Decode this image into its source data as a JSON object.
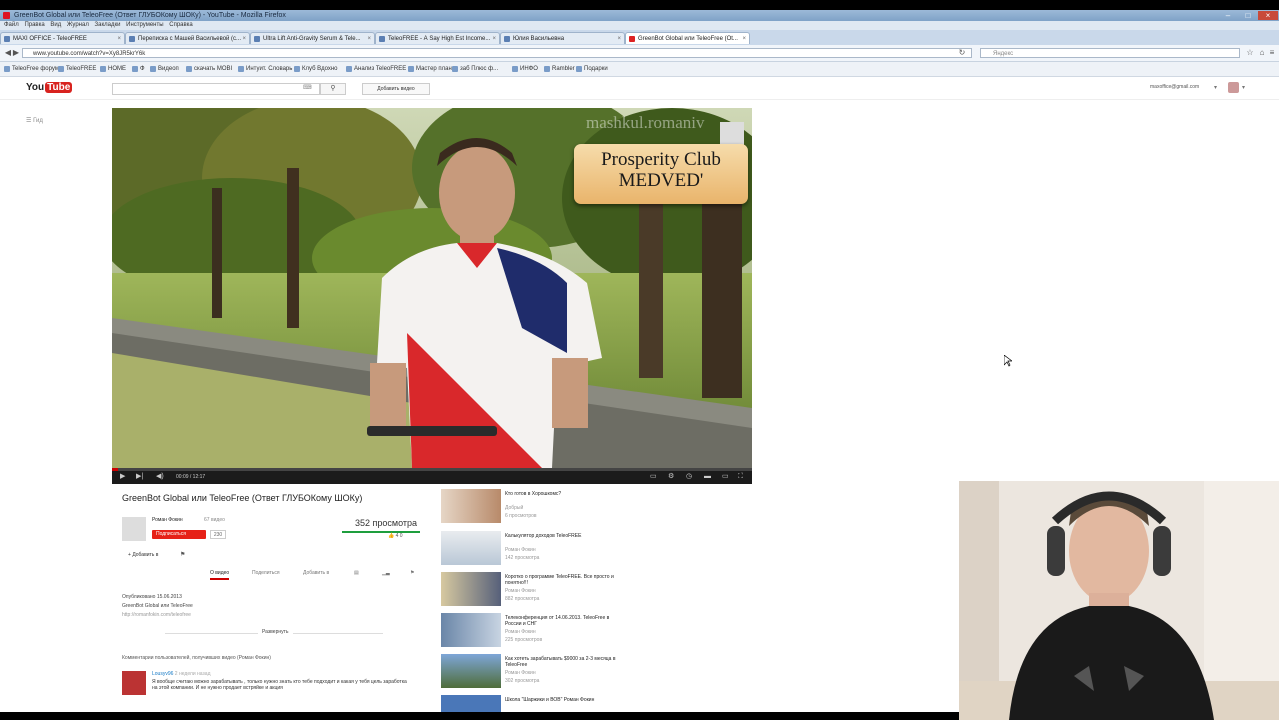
{
  "window": {
    "title": "GreenBot Global или TeleoFree (Ответ ГЛУБОКому ШОКу) - YouTube - Mozilla Firefox",
    "menu": [
      "Файл",
      "Правка",
      "Вид",
      "Журнал",
      "Закладки",
      "Инструменты",
      "Справка"
    ]
  },
  "tabs": [
    {
      "label": "MAXI OFFICE - TeleoFREE",
      "active": false
    },
    {
      "label": "Переписка с Машей Васильевой (с...",
      "active": false
    },
    {
      "label": "Ultra Lift Anti-Gravity Serum & Tele...",
      "active": false
    },
    {
      "label": "TeleoFREE - А Say High Est Income...",
      "active": false
    },
    {
      "label": "Юлия Васильевна",
      "active": false
    },
    {
      "label": "GreenBot Global или TeleoFree (Ot...",
      "active": true
    }
  ],
  "nav": {
    "url": "www.youtube.com/watch?v=Xy8JR5krY6k",
    "search_placeholder": "Яндекс"
  },
  "bookmarks": [
    "TeleoFree форум",
    "TeleoFREE",
    "HOME",
    "Ф",
    "Видеоп",
    "скачать MOBI",
    "Интуит. Словарь",
    "Клуб Вдохно",
    "Анализ TeleoFREE",
    "Мастер план",
    "заб Плюс ф...",
    "ИНФО",
    "Rambler",
    "Подарки"
  ],
  "youtube": {
    "logo_you": "You",
    "logo_tube": "Tube",
    "upload_label": "Добавить видео",
    "user_email": "maxoffice@gmail.com",
    "guide_label": "Гид"
  },
  "video": {
    "watermark": "mashkul.romaniv",
    "card_line1": "Prosperity Club",
    "card_line2": "MEDVED'",
    "time": "00:09 / 12:17",
    "progress": 0.01
  },
  "info": {
    "title": "GreenBot Global или TeleoFree (Ответ ГЛУБОКому ШОКу)",
    "channel": "Роман Фокин",
    "video_count": "67 видео",
    "subscribe": "Подписаться",
    "sub_count": "230",
    "views": "352 просмотра",
    "likes": "4   0",
    "add_to": "Добавить в",
    "tabs": [
      "О видео",
      "Поделиться",
      "Добавить в",
      "Статистика",
      "Ещё",
      "Пожаловаться"
    ],
    "published": "Опубликовано 15.06.2013",
    "description": "GreenBot Global или TeleoFree",
    "desc_link": "http://romanfokin.com/teleofree",
    "more": "Развернуть",
    "comments_header": "Комментарии пользователей, получивших видео (Роман Фокин)",
    "comment_author": "Lousyv96",
    "comment_time": "2 недели назад",
    "comment_text": "Я вообще считаю можно зарабатывать , только нужно знать кто тебе подходит и какая у тебя цель заработка на этой компании. И не нужно продает встряйке и акция"
  },
  "related": [
    {
      "title": "Кто готов в Хорошкомс?",
      "author": "Добрый",
      "views": "6 просмотров"
    },
    {
      "title": "Калькулятор доходов TeleoFREE",
      "author": "Роман Фокин",
      "views": "142 просмотра"
    },
    {
      "title": "Коротко о программе TeleoFREE. Все просто и понятно!!!",
      "author": "Роман Фокин",
      "views": "882 просмотра"
    },
    {
      "title": "Телеконференция от 14.06.2013. TeleoFree в России и СНГ",
      "author": "Роман Фокин",
      "views": "225 просмотров"
    },
    {
      "title": "Как хотеть зарабатывать $9000 за 2-3 месяца в TeleoFree",
      "author": "Роман Фокин",
      "views": "302 просмотра"
    },
    {
      "title": "Школа \"Шаржики и ВОВ\" Роман Фокин",
      "author": "",
      "views": ""
    }
  ],
  "colors": {
    "accent": "#e62117",
    "link": "#167ac6",
    "views_bar": "#1e9e3e"
  }
}
